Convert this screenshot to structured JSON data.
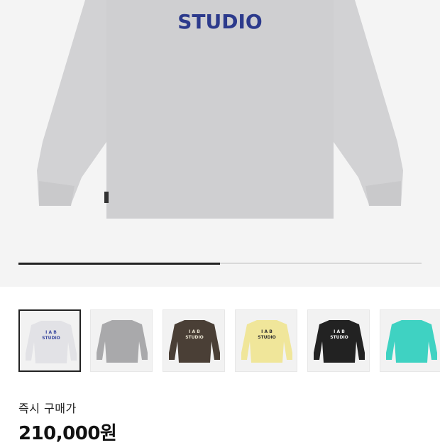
{
  "hero": {
    "print_text": "STUDIO",
    "print_color": "#2c3a8c",
    "shirt_color": "#d4d4d6",
    "gallery_progress": 0.5
  },
  "thumbnails": [
    {
      "color": "#e2e2e6",
      "print": "#3c4aa0",
      "logo_top": "I A B",
      "logo_bottom": "STUDIO",
      "selected": true
    },
    {
      "color": "#a9a9ab",
      "print": "#a9a9ab",
      "logo_top": "",
      "logo_bottom": "",
      "selected": false
    },
    {
      "color": "#4a3f36",
      "print": "#e8e2d0",
      "logo_top": "I A B",
      "logo_bottom": "STUDIO",
      "selected": false
    },
    {
      "color": "#f0e69a",
      "print": "#2f2f2f",
      "logo_top": "I A B",
      "logo_bottom": "STUDIO",
      "selected": false
    },
    {
      "color": "#222222",
      "print": "#f2f2f2",
      "logo_top": "I A B",
      "logo_bottom": "STUDIO",
      "selected": false
    },
    {
      "color": "#3fd2c2",
      "print": "#ffffff",
      "logo_top": "",
      "logo_bottom": "",
      "selected": false
    }
  ],
  "price_section": {
    "label": "즉시 구매가",
    "price": "210,000원"
  }
}
